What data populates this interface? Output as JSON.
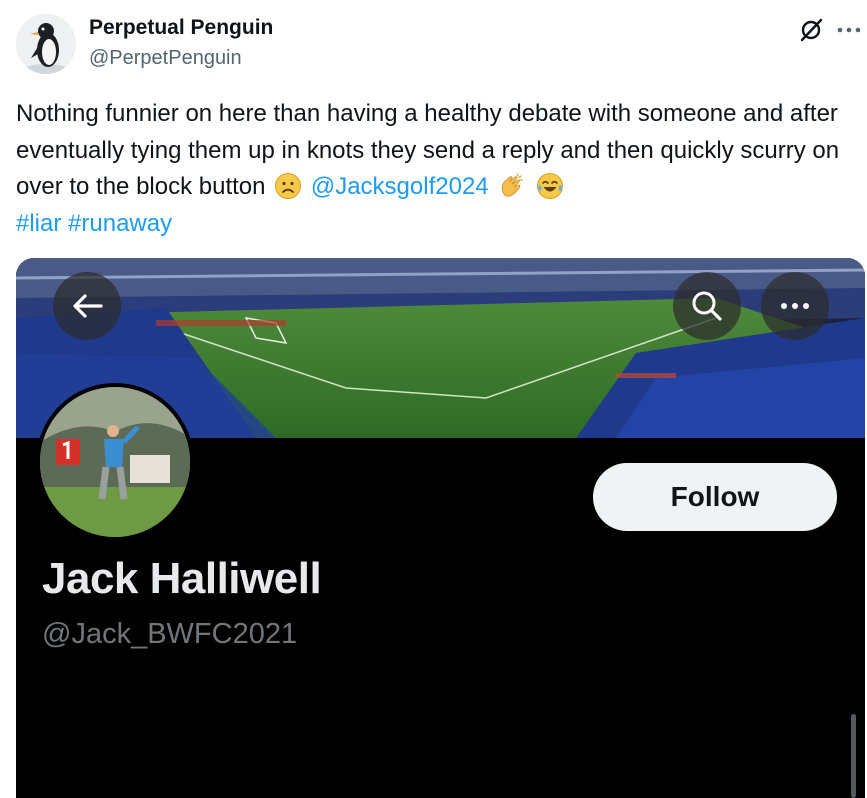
{
  "author": {
    "display_name": "Perpetual Penguin",
    "handle": "@PerpetPenguin"
  },
  "header_icons": {
    "grok": "slashed-circle-icon",
    "more": "more-dots-icon"
  },
  "tweet": {
    "text_main": "Nothing funnier on here than having a healthy debate with someone and after eventually tying them up in knots they send a reply and then quickly scurry on over to the block button",
    "emoji_sad": "frowning-face-emoji",
    "mention": "@Jacksgolf2024",
    "emoji_clap": "clapping-hands-emoji",
    "emoji_laugh": "tears-of-joy-emoji",
    "hashtag_1": "#liar",
    "hashtag_2": "#runaway"
  },
  "embedded_profile": {
    "banner": "football-stadium-photo",
    "avatar": "golfer-photo",
    "follow_label": "Follow",
    "name": "Jack Halliwell",
    "handle": "@Jack_BWFC2021",
    "icons": {
      "back": "back-arrow-icon",
      "search": "search-icon",
      "more": "more-dots-icon"
    }
  },
  "colors": {
    "link": "#1d9bf0",
    "text": "#0f1419",
    "muted": "#536471",
    "profile_bg": "#000000"
  }
}
